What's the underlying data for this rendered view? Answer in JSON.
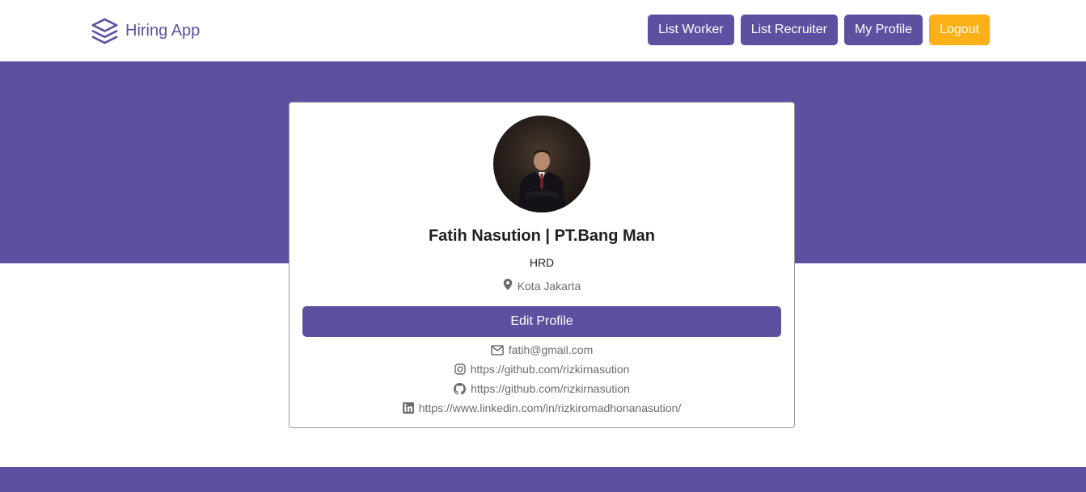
{
  "brand": {
    "name": "Hiring App",
    "icon": "layers-icon"
  },
  "nav": {
    "list_worker": "List Worker",
    "list_recruiter": "List Recruiter",
    "my_profile": "My Profile",
    "logout": "Logout"
  },
  "colors": {
    "primary": "#5e50a1",
    "accent": "#fbb017",
    "muted_text": "#6b6b6b"
  },
  "profile": {
    "name": "Fatih Nasution | PT.Bang Man",
    "role": "HRD",
    "location": "Kota Jakarta",
    "edit_button": "Edit Profile",
    "contacts": {
      "email": "fatih@gmail.com",
      "instagram": "https://github.com/rizkirnasution",
      "github": "https://github.com/rizkirnasution",
      "linkedin": "https://www.linkedin.com/in/rizkiromadhonanasution/"
    }
  }
}
